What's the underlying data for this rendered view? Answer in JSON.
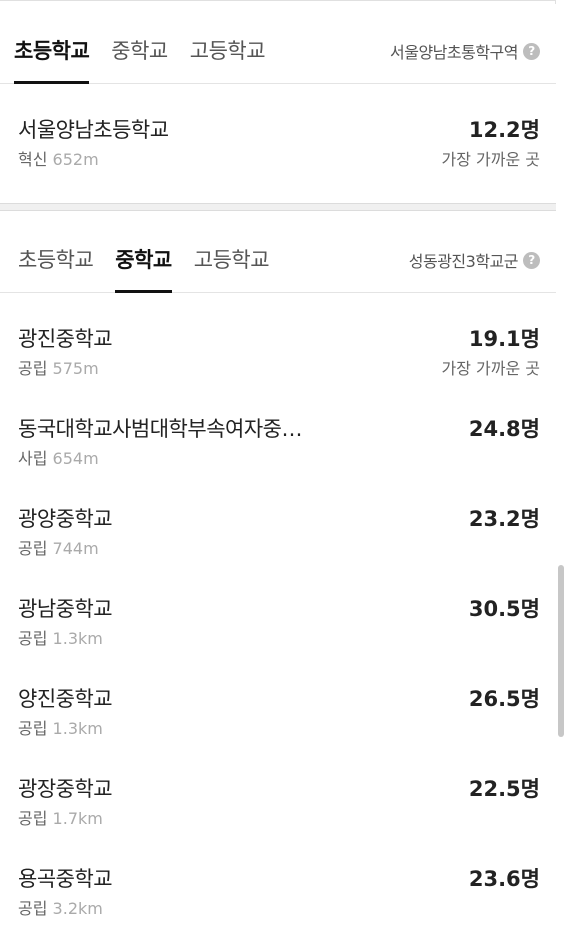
{
  "elementary": {
    "tabs": [
      "초등학교",
      "중학교",
      "고등학교"
    ],
    "active_tab": 0,
    "district": "서울양남초통학구역",
    "schools": [
      {
        "name": "서울양남초등학교",
        "type": "혁신",
        "distance": "652m",
        "ratio": "12.2명",
        "note": "가장 가까운 곳"
      }
    ]
  },
  "middle": {
    "tabs": [
      "초등학교",
      "중학교",
      "고등학교"
    ],
    "active_tab": 1,
    "district": "성동광진3학교군",
    "schools": [
      {
        "name": "광진중학교",
        "type": "공립",
        "distance": "575m",
        "ratio": "19.1명",
        "note": "가장 가까운 곳"
      },
      {
        "name": "동국대학교사범대학부속여자중…",
        "type": "사립",
        "distance": "654m",
        "ratio": "24.8명",
        "note": ""
      },
      {
        "name": "광양중학교",
        "type": "공립",
        "distance": "744m",
        "ratio": "23.2명",
        "note": ""
      },
      {
        "name": "광남중학교",
        "type": "공립",
        "distance": "1.3km",
        "ratio": "30.5명",
        "note": ""
      },
      {
        "name": "양진중학교",
        "type": "공립",
        "distance": "1.3km",
        "ratio": "26.5명",
        "note": ""
      },
      {
        "name": "광장중학교",
        "type": "공립",
        "distance": "1.7km",
        "ratio": "22.5명",
        "note": ""
      },
      {
        "name": "용곡중학교",
        "type": "공립",
        "distance": "3.2km",
        "ratio": "23.6명",
        "note": ""
      }
    ]
  },
  "help_icon_glyph": "?"
}
